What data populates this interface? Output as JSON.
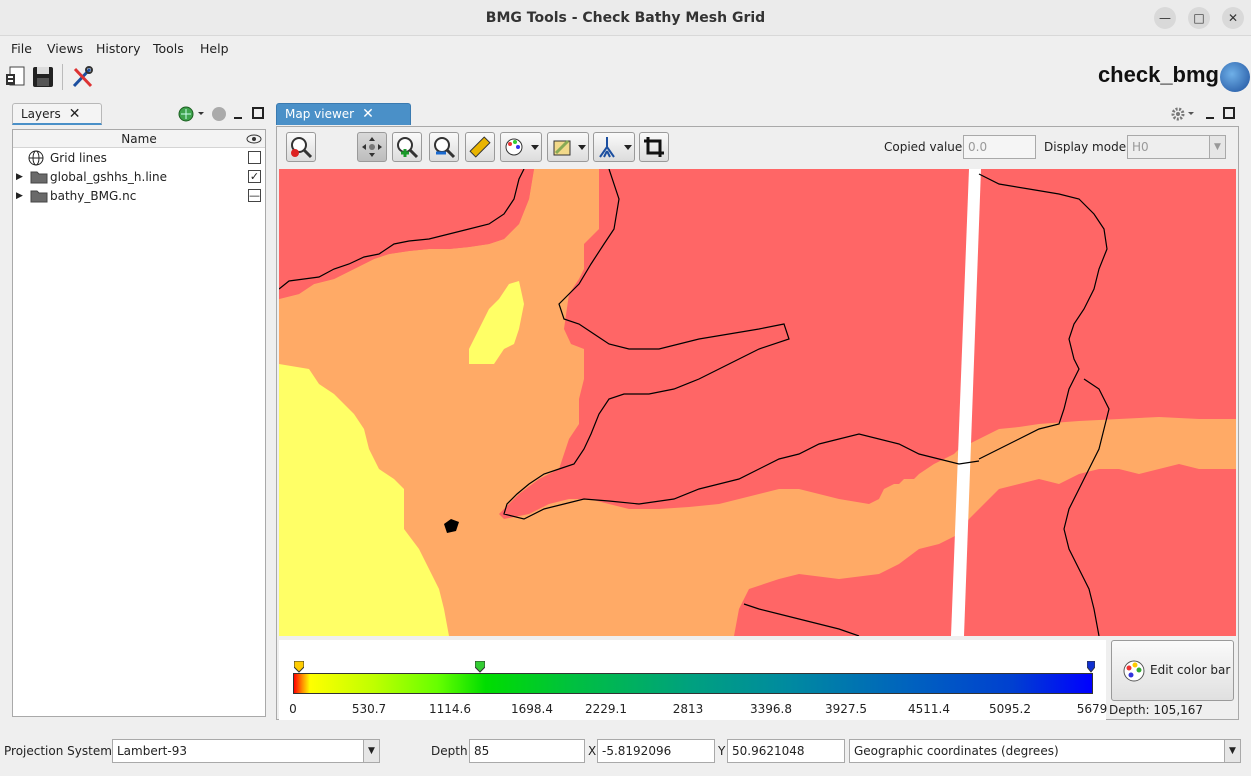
{
  "window": {
    "title": "BMG Tools - Check Bathy Mesh Grid",
    "min_glyph": "—",
    "max_glyph": "□",
    "close_glyph": "✕"
  },
  "menu": [
    "File",
    "Views",
    "History",
    "Tools",
    "Help"
  ],
  "app_logo": "check_bmg",
  "layers": {
    "tab_label": "Layers",
    "column_name": "Name",
    "items": [
      {
        "label": "Grid lines",
        "checked": false
      },
      {
        "label": "global_gshhs_h.line",
        "checked": true
      },
      {
        "label": "bathy_BMG.nc",
        "checked": "partial"
      }
    ]
  },
  "map_viewer": {
    "tab_label": "Map viewer",
    "copied_value_label": "Copied value",
    "copied_value": "0.0",
    "display_mode_label": "Display mode",
    "display_mode": "H0"
  },
  "colorbar": {
    "ticks": [
      "0",
      "530.7",
      "1114.6",
      "1698.4",
      "2229.1",
      "2813",
      "3396.8",
      "3927.5",
      "4511.4",
      "5095.2",
      "5679"
    ],
    "edit_label": "Edit color bar",
    "depth_readout": "Depth: 105,167"
  },
  "statusbar": {
    "projection_label": "Projection System:",
    "projection_value": "Lambert-93",
    "depth_label": "Depth",
    "depth_value": "85",
    "x_label": "X",
    "x_value": "-5.8192096",
    "y_label": "Y",
    "y_value": "50.9621048",
    "coord_mode": "Geographic coordinates (degrees)"
  },
  "colors": {
    "shallow_red": "#ff6666",
    "mid_orange": "#ffaa66",
    "deep_yellow": "#ffff66",
    "tab_blue": "#4a90c8"
  }
}
